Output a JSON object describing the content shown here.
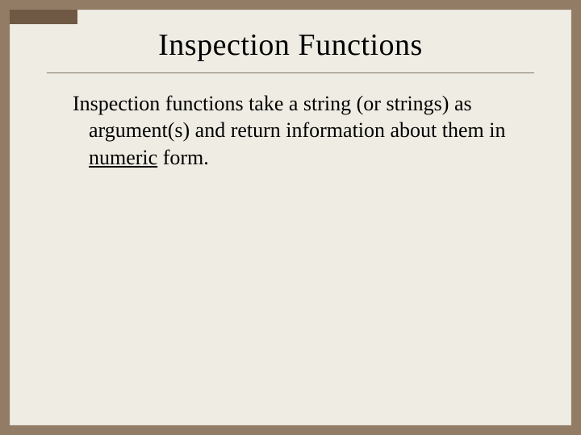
{
  "slide": {
    "title": "Inspection Functions",
    "body_pre": "Inspection functions take a string (or strings) as argument(s) and return information about them in ",
    "body_underlined": "numeric",
    "body_post": " form."
  }
}
